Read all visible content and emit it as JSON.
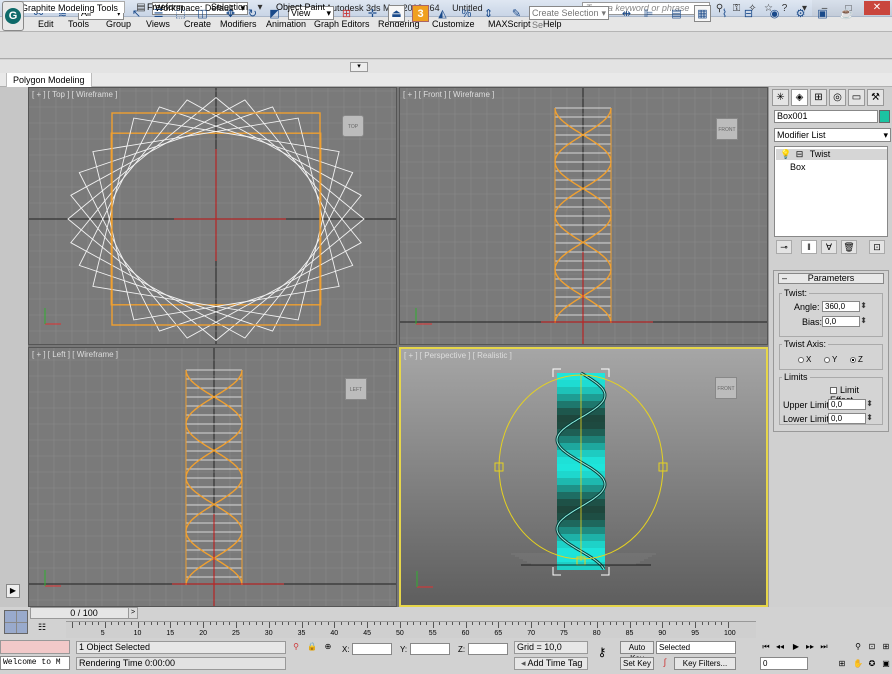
{
  "titlebar": {
    "workspace_label": "Workspace: Default",
    "app_title": "Autodesk 3ds Max  2013 x64",
    "doc_title": "Untitled",
    "search_placeholder": "Type a keyword or phrase"
  },
  "menu": [
    "Edit",
    "Tools",
    "Group",
    "Views",
    "Create",
    "Modifiers",
    "Animation",
    "Graph Editors",
    "Rendering",
    "Customize",
    "MAXScript",
    "Help"
  ],
  "toolbar": {
    "selection_filter": "All",
    "ref_coord": "View",
    "snap_label": "3",
    "named_selection_placeholder": "Create Selection Se"
  },
  "ribbon": {
    "tabs": [
      "Graphite Modeling Tools",
      "Freeform",
      "Selection",
      "Object Paint"
    ],
    "active_tab": "Graphite Modeling Tools",
    "panel_label": "Polygon Modeling"
  },
  "viewports": [
    {
      "label": "[ + ] [ Top ] [ Wireframe ]",
      "cube": "TOP"
    },
    {
      "label": "[ + ] [ Front ] [ Wireframe ]",
      "cube": "FRONT"
    },
    {
      "label": "[ + ] [ Left ] [ Wireframe ]",
      "cube": "LEFT"
    },
    {
      "label": "[ + ] [ Perspective ] [ Realistic ]",
      "cube": "FRONT"
    }
  ],
  "command_panel": {
    "object_name": "Box001",
    "object_color": "#1cc4a2",
    "modifier_list": "Modifier List",
    "stack": [
      "Twist",
      "Box"
    ],
    "parameters": {
      "title": "Parameters",
      "twist_group": "Twist:",
      "angle_label": "Angle:",
      "angle_value": "360,0",
      "bias_label": "Bias:",
      "bias_value": "0,0",
      "axis_group": "Twist Axis:",
      "axes": [
        "X",
        "Y",
        "Z"
      ],
      "selected_axis": "Z",
      "limits_group": "Limits",
      "limit_effect": "Limit Effect",
      "upper_label": "Upper Limit:",
      "upper_value": "0,0",
      "lower_label": "Lower Limit:",
      "lower_value": "0,0"
    }
  },
  "status": {
    "time_slider": "0 / 100",
    "ticks": [
      "5",
      "10",
      "15",
      "20",
      "25",
      "30",
      "35",
      "40",
      "45",
      "50",
      "55",
      "60",
      "65",
      "70",
      "75",
      "80",
      "85",
      "90",
      "95",
      "100"
    ],
    "maxscript_text": "Welcome to M",
    "selection_info": "1 Object Selected",
    "render_time": "Rendering Time  0:00:00",
    "x_label": "X:",
    "y_label": "Y:",
    "z_label": "Z:",
    "grid": "Grid = 10,0",
    "add_time_tag": "Add Time Tag",
    "auto_key": "Auto Key",
    "set_key": "Set Key",
    "key_mode": "Selected",
    "key_filters": "Key Filters...",
    "frame_value": "0"
  }
}
